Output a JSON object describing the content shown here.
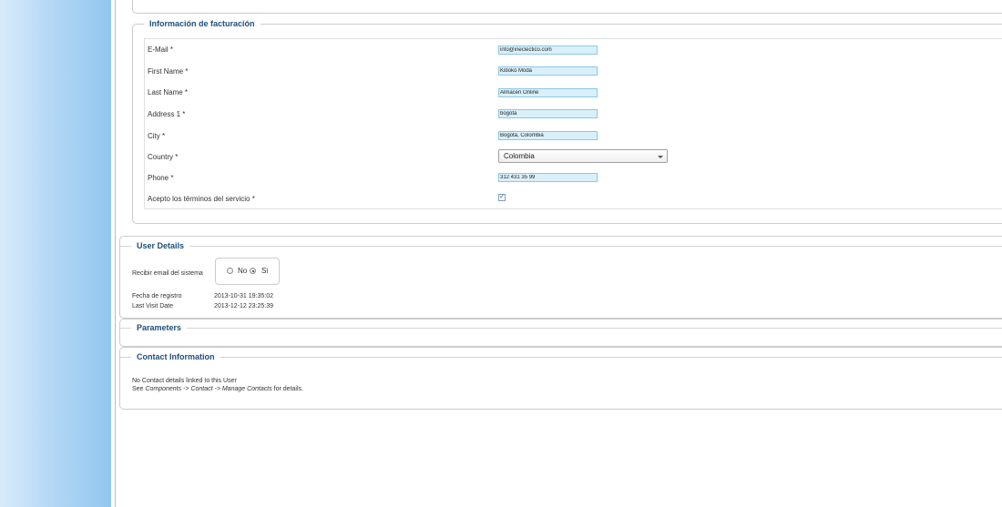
{
  "billing": {
    "legend": "Información de facturación",
    "email_label": "E-Mail *",
    "email_value": "info@ineclectico.com",
    "first_name_label": "First Name *",
    "first_name_value": "Kiboko Moda",
    "last_name_label": "Last Name *",
    "last_name_value": "Almacen Online",
    "address1_label": "Address 1 *",
    "address1_value": "bogota",
    "city_label": "City *",
    "city_value": "Bogota, Colombia",
    "country_label": "Country *",
    "country_value": "Colombia",
    "phone_label": "Phone *",
    "phone_value": "312 431 35 99",
    "terms_label": "Acepto los términos del servicio *",
    "terms_checked": true,
    "checkmark": "✓"
  },
  "user_details": {
    "legend": "User Details",
    "receive_email_label": "Recibir email del sistema",
    "option_no": "No",
    "option_si": "Si",
    "selected": "Si",
    "register_date_label": "Fecha de registro",
    "register_date_value": "2013-10-31 19:35:02",
    "last_visit_label": "Last Visit Date",
    "last_visit_value": "2013-12-12 23:25:39"
  },
  "parameters": {
    "legend": "Parameters"
  },
  "contact_info": {
    "legend": "Contact Information",
    "line1": "No Contact details linked to this User",
    "see": "See",
    "path": "Components -> Contact -> Manage Contacts",
    "for_details": "for details."
  },
  "colors": {
    "legend_text": "#1e4e79",
    "input_bg": "#d9f0fa",
    "input_border": "#8cc7e6",
    "sidebar": "#93c6ee"
  }
}
